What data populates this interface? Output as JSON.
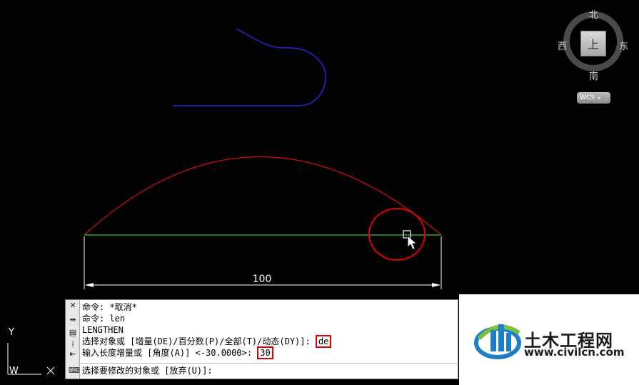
{
  "drawing": {
    "dimension_value": "100",
    "colors": {
      "background": "#000000",
      "blue_curve": "#1f2bd9",
      "red_arc": "#d40d0d",
      "green_line": "#3fc43f",
      "dim_line": "#ffffff",
      "highlight": "#e00000"
    }
  },
  "viewcube": {
    "north": "北",
    "south": "南",
    "west": "西",
    "east": "东",
    "face": "上",
    "wcs": "WCS"
  },
  "ucs": {
    "y_label": "Y",
    "w_label": "W"
  },
  "command": {
    "history": [
      "命令: *取消*",
      "命令: len",
      "LENGTHEN"
    ],
    "line4_prefix": "选择对象或 [增量(DE)/百分数(P)/全部(T)/动态(DY)]: ",
    "line4_value": "de",
    "line5_prefix": "输入长度增量或 [角度(A)] <-30.0000>: ",
    "line5_value": "30",
    "prompt": "选择要修改的对象或 [放弃(U)]:"
  },
  "watermark": {
    "title": "土木工程网",
    "url": "www.civilcn.com"
  }
}
